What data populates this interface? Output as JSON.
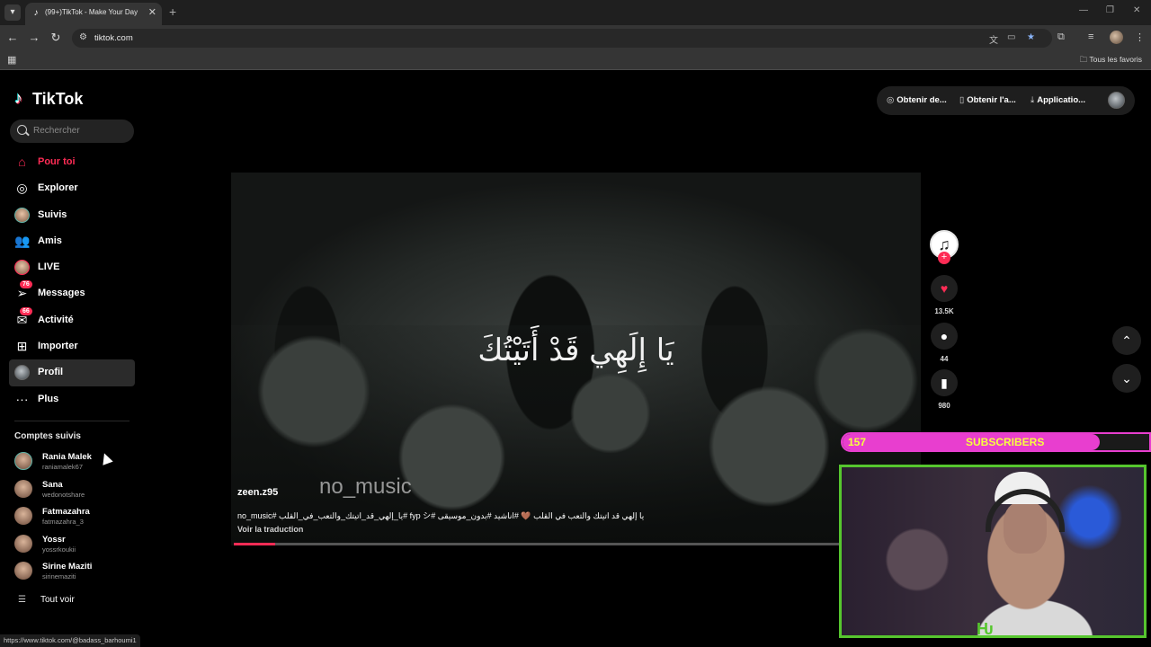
{
  "browser": {
    "tab_title": "(99+)TikTok - Make Your Day",
    "url": "tiktok.com",
    "bookmarks_all": "Tous les favoris",
    "status_url": "https://www.tiktok.com/@badass_barhoumi1"
  },
  "sidebar": {
    "logo": "TikTok",
    "search_placeholder": "Rechercher",
    "nav": [
      {
        "label": "Pour toi",
        "icon": "home-icon"
      },
      {
        "label": "Explorer",
        "icon": "compass-icon"
      },
      {
        "label": "Suivis",
        "icon": "following-avatar"
      },
      {
        "label": "Amis",
        "icon": "friends-icon"
      },
      {
        "label": "LIVE",
        "icon": "live-avatar"
      },
      {
        "label": "Messages",
        "icon": "send-icon",
        "badge": "76"
      },
      {
        "label": "Activité",
        "icon": "inbox-icon",
        "badge": "66"
      },
      {
        "label": "Importer",
        "icon": "upload-icon"
      },
      {
        "label": "Profil",
        "icon": "profile-avatar"
      },
      {
        "label": "Plus",
        "icon": "more-icon"
      }
    ],
    "following_title": "Comptes suivis",
    "following": [
      {
        "name": "Rania Malek",
        "user": "raniamalek67"
      },
      {
        "name": "Sana",
        "user": "wedonotshare"
      },
      {
        "name": "Fatmazahra",
        "user": "fatmazahra_3"
      },
      {
        "name": "Yossr",
        "user": "yossrkoukii"
      },
      {
        "name": "Sirine Maziti",
        "user": "sirinemaziti"
      }
    ],
    "see_all": "Tout voir"
  },
  "topbar": {
    "btn1": "Obtenir de...",
    "btn2": "Obtenir l'a...",
    "btn3": "Applicatio..."
  },
  "video": {
    "overlay_text": "يَا إِلَهِي قَدْ أَتَيْتُكَ",
    "watermark": "no_music",
    "author": "zeen.z95",
    "description": "يا إلهي قد اتيتك والتعب في القلب 🤎 #اناشيد #بدون_موسيقى #fyp シ #يا_إلهي_قد_اتيتك_والتعب_في_القلب #no_music",
    "translate": "Voir la traduction",
    "progress": 0.06
  },
  "actions": {
    "likes": "13.5K",
    "comments": "44",
    "saves": "980"
  },
  "overlay": {
    "sub_count": "157",
    "sub_label": "SUBSCRIBERS",
    "sub_progress": 0.84
  }
}
